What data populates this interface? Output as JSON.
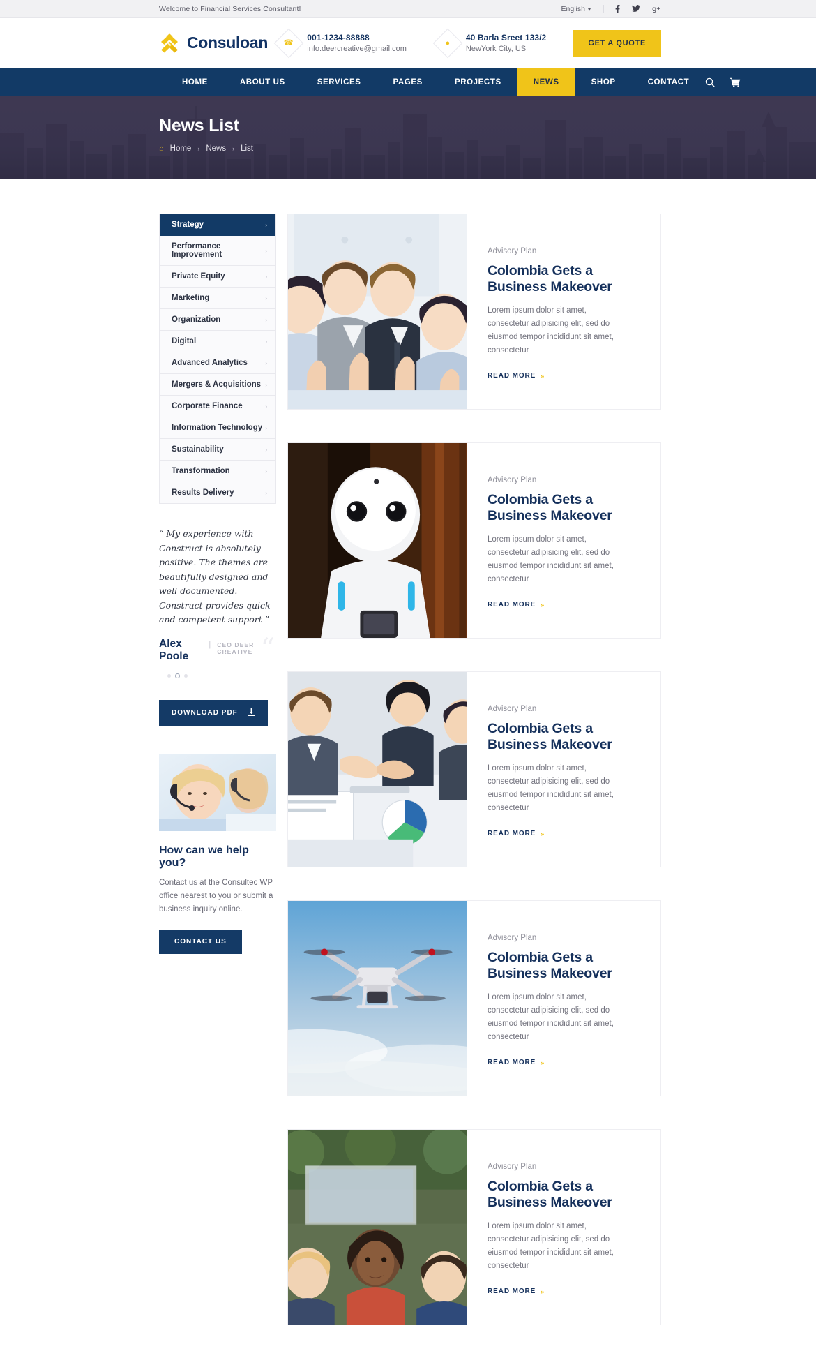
{
  "topbar": {
    "welcome": "Welcome to Financial Services Consultant!",
    "language": "English",
    "chevron": "⌄",
    "socials": [
      {
        "name": "facebook-icon",
        "glyph": "f"
      },
      {
        "name": "twitter-icon",
        "glyph": "t"
      },
      {
        "name": "google-plus-icon",
        "glyph": "g+"
      }
    ]
  },
  "header": {
    "brand": "Consuloan",
    "phone_icon": "phone-icon",
    "phone": "001-1234-88888",
    "email": "info.deercreative@gmail.com",
    "location_icon": "map-pin-icon",
    "address_line1": "40 Barla Sreet 133/2",
    "address_line2": "NewYork City, US",
    "quote_button": "GET A QUOTE"
  },
  "nav": {
    "items": [
      {
        "label": "HOME",
        "active": false
      },
      {
        "label": "ABOUT US",
        "active": false
      },
      {
        "label": "SERVICES",
        "active": false
      },
      {
        "label": "PAGES",
        "active": false
      },
      {
        "label": "PROJECTS",
        "active": false
      },
      {
        "label": "NEWS",
        "active": true
      },
      {
        "label": "SHOP",
        "active": false
      },
      {
        "label": "CONTACT",
        "active": false
      }
    ],
    "search_icon": "search-icon",
    "cart_icon": "shopping-cart-icon"
  },
  "hero": {
    "title": "News List",
    "home_icon": "home-icon",
    "breadcrumbs": [
      "Home",
      "News",
      "List"
    ],
    "separator": "›"
  },
  "sidebar": {
    "categories": [
      {
        "label": "Strategy",
        "active": true
      },
      {
        "label": "Performance Improvement",
        "active": false
      },
      {
        "label": "Private Equity",
        "active": false
      },
      {
        "label": "Marketing",
        "active": false
      },
      {
        "label": "Organization",
        "active": false
      },
      {
        "label": "Digital",
        "active": false
      },
      {
        "label": "Advanced Analytics",
        "active": false
      },
      {
        "label": "Mergers & Acquisitions",
        "active": false
      },
      {
        "label": "Corporate Finance",
        "active": false
      },
      {
        "label": "Information Technology",
        "active": false
      },
      {
        "label": "Sustainability",
        "active": false
      },
      {
        "label": "Transformation",
        "active": false
      },
      {
        "label": "Results Delivery",
        "active": false
      }
    ],
    "category_arrow": "›",
    "testimonial": {
      "quote": "“ My experience with Construct is absolutely positive. The themes are beautifully designed and well documented. Construct provides quick and competent support ”",
      "author": "Alex Poole",
      "divider": "|",
      "role": "CEO DEER CREATIVE",
      "quote_mark": "“",
      "dots": [
        false,
        true,
        false
      ]
    },
    "download_button": "DOWNLOAD PDF",
    "download_icon": "download-icon",
    "help_image": "call-center-agents-photo",
    "help_title": "How can we help you?",
    "help_text": "Contact us at the Consultec WP office nearest to you or submit a business inquiry online.",
    "contact_button": "CONTACT US"
  },
  "news": {
    "read_more_label": "READ MORE",
    "read_more_arrow": "»",
    "cards": [
      {
        "image": "business-team-thumbs-up-photo",
        "category": "Advisory Plan",
        "title": "Colombia Gets a Business Makeover",
        "description": "Lorem ipsum dolor sit amet, consectetur adipisicing elit, sed do eiusmod tempor incididunt sit amet, consectetur"
      },
      {
        "image": "white-humanoid-robot-photo",
        "category": "Advisory Plan",
        "title": "Colombia Gets a Business Makeover",
        "description": "Lorem ipsum dolor sit amet, consectetur adipisicing elit, sed do eiusmod tempor incididunt sit amet, consectetur"
      },
      {
        "image": "business-handshake-meeting-photo",
        "category": "Advisory Plan",
        "title": "Colombia Gets a Business Makeover",
        "description": "Lorem ipsum dolor sit amet, consectetur adipisicing elit, sed do eiusmod tempor incididunt sit amet, consectetur"
      },
      {
        "image": "flying-drone-photo",
        "category": "Advisory Plan",
        "title": "Colombia Gets a Business Makeover",
        "description": "Lorem ipsum dolor sit amet, consectetur adipisicing elit, sed do eiusmod tempor incididunt sit amet, consectetur"
      },
      {
        "image": "group-of-people-outdoors-photo",
        "category": "Advisory Plan",
        "title": "Colombia Gets a Business Makeover",
        "description": "Lorem ipsum dolor sit amet, consectetur adipisicing elit, sed do eiusmod tempor incididunt sit amet, consectetur"
      }
    ]
  },
  "colors": {
    "accent_yellow": "#f0c419",
    "navy": "#123a66",
    "heading_navy": "#16315c",
    "topbar_bg": "#f1f1f3",
    "hero_overlay": "#3a354e"
  }
}
